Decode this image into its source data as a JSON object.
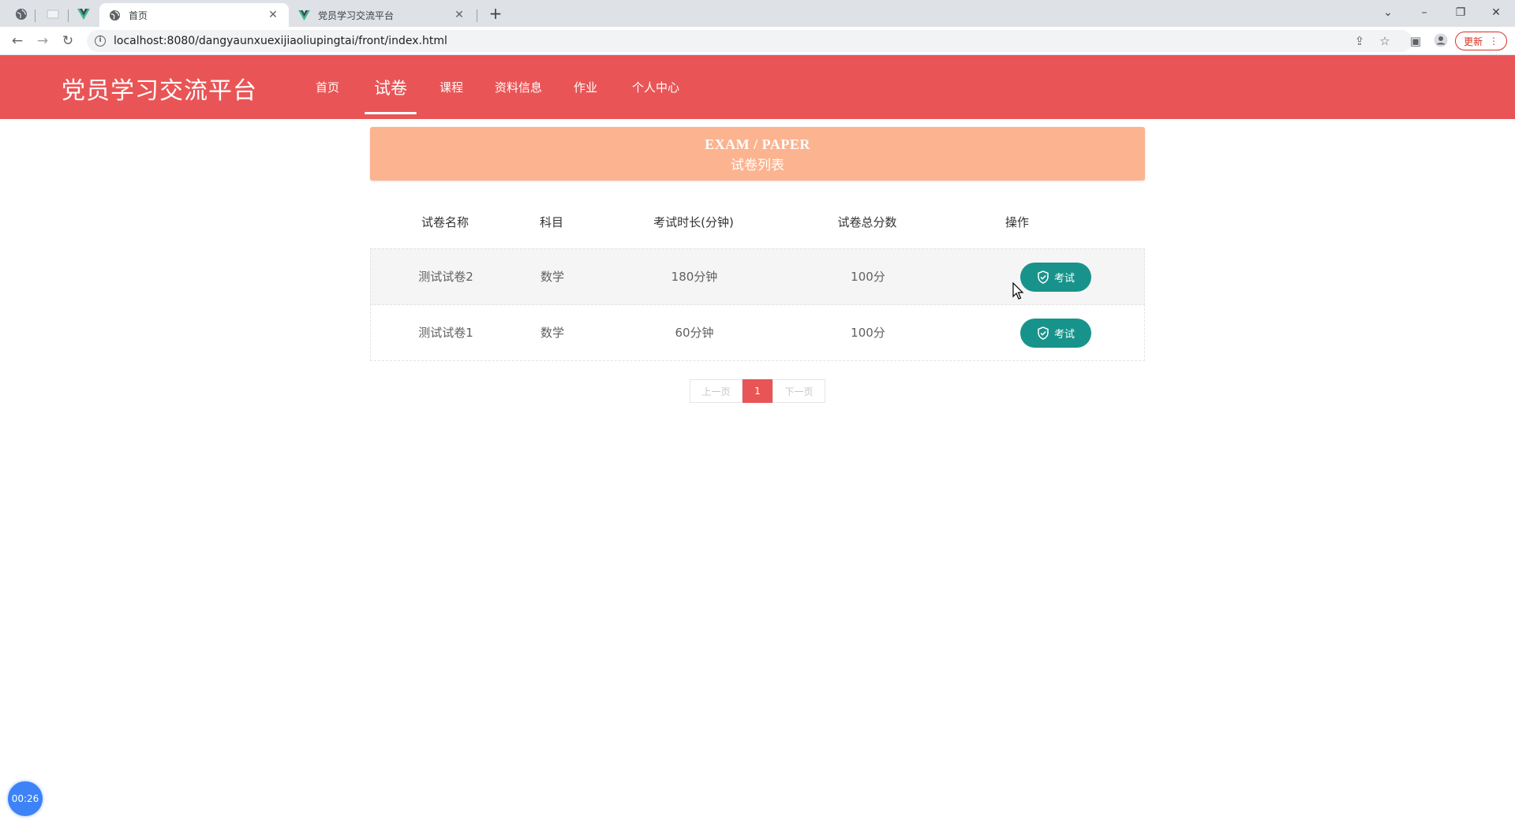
{
  "browser": {
    "tabs": [
      {
        "title": "首页",
        "active": true
      },
      {
        "title": "党员学习交流平台",
        "active": false
      }
    ],
    "url": "localhost:8080/dangyaunxuexijiaoliupingtai/front/index.html",
    "update_label": "更新"
  },
  "site": {
    "logo": "党员学习交流平台",
    "nav": [
      "首页",
      "试卷",
      "课程",
      "资料信息",
      "作业",
      "个人中心"
    ],
    "active_nav": "试卷"
  },
  "banner": {
    "en": "EXAM / PAPER",
    "cn": "试卷列表"
  },
  "table": {
    "headers": [
      "试卷名称",
      "科目",
      "考试时长(分钟)",
      "试卷总分数",
      "操作"
    ],
    "rows": [
      {
        "name": "测试试卷2",
        "subject": "数学",
        "duration": "180分钟",
        "score": "100分",
        "action": "考试"
      },
      {
        "name": "测试试卷1",
        "subject": "数学",
        "duration": "60分钟",
        "score": "100分",
        "action": "考试"
      }
    ]
  },
  "pagination": {
    "prev": "上一页",
    "current": "1",
    "next": "下一页"
  },
  "timer": "00:26",
  "colors": {
    "header": "#e95556",
    "banner": "#fcb38f",
    "button": "#18938b",
    "timer": "#3d82f6"
  }
}
